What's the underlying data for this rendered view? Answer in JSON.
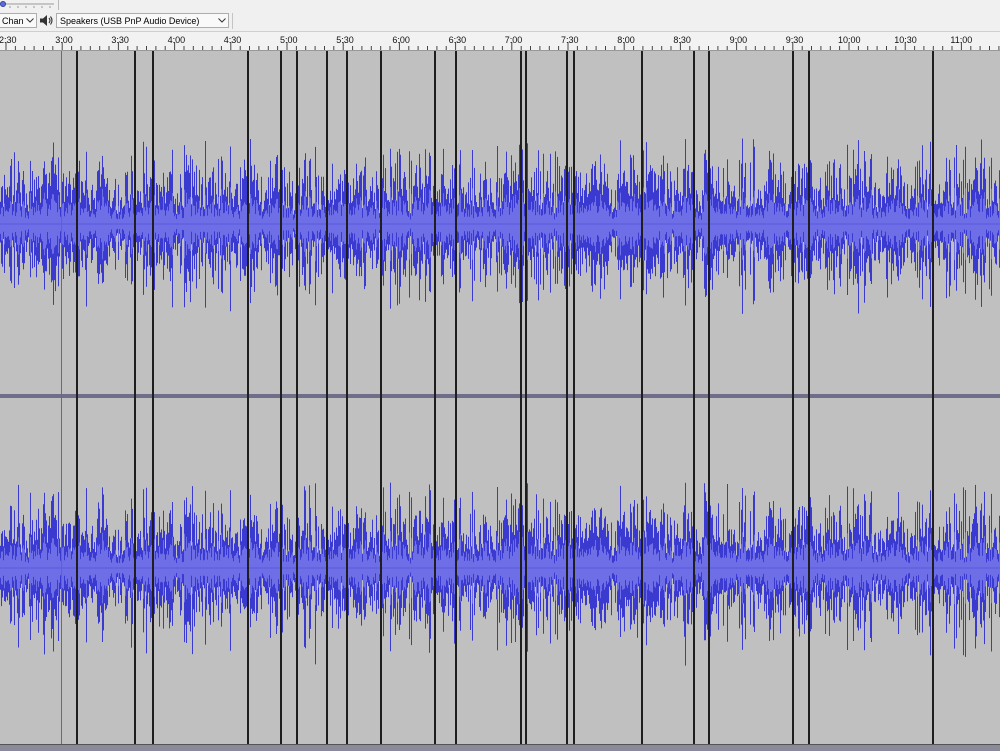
{
  "toolbar": {
    "channels_label": "Chann",
    "output_device": "Speakers (USB PnP Audio Device)"
  },
  "timeline": {
    "labels": [
      "2:30",
      "3:00",
      "3:30",
      "4:00",
      "4:30",
      "5:00",
      "5:30",
      "6:00",
      "6:30",
      "7:00",
      "7:30",
      "8:00",
      "8:30",
      "9:00",
      "9:30",
      "10:00",
      "10:30",
      "11:00"
    ]
  },
  "colors": {
    "waveform": "#3a3ad0",
    "waveform_rms": "#6e6ee6",
    "track_background": "#c0c0c0",
    "clip_boundary": "#1e1e1e"
  },
  "icons": [
    "speaker-icon",
    "chevron-down-icon",
    "slider-thumb-icon"
  ]
}
